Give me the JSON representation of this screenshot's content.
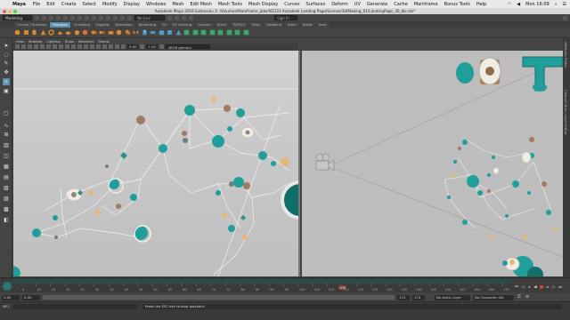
{
  "macmenu": {
    "app": "Maya",
    "items": [
      "File",
      "Edit",
      "Create",
      "Select",
      "Modify",
      "Display",
      "Windows",
      "Mesh",
      "Edit Mesh",
      "Mesh Tools",
      "Mesh Display",
      "Curves",
      "Surfaces",
      "Deform",
      "UV",
      "Generate",
      "Cache",
      "Mainframe",
      "Bonus Tools",
      "Help"
    ],
    "clock": "Mon 16:09"
  },
  "window": {
    "title": "Autodesk Maya 2016 Extension 2: /Volumes/Mainframe_Jobs/N1233 Autodesk Landing Page/Scenes/3d/Making_01/LandingPage_30_bb.mb*"
  },
  "statusline": {
    "mode": "Modeling",
    "live_surface": "No Live Surface",
    "signin": "Sign In"
  },
  "shelf": {
    "tabs": [
      "Curves / Surfaces",
      "Polygons",
      "Sculpting",
      "Rigging",
      "Animation",
      "Rendering",
      "FX",
      "FX Caching",
      "Custom",
      "XGen",
      "TURTLE",
      "VRay",
      "Deadline",
      "Interl",
      "Bullet",
      "Xero"
    ],
    "active_tab": "Polygons"
  },
  "panel": {
    "menu": [
      "View",
      "Shading",
      "Lighting",
      "Show",
      "Renderer",
      "Panels"
    ],
    "near": "0.00",
    "far": "1.00",
    "colorspace": "sRGB gamma"
  },
  "side_tabs": [
    "Attribute Editor",
    "Channel Box / Layer Editor"
  ],
  "timeline": {
    "ticks": [
      "5",
      "10",
      "15",
      "20",
      "25",
      "30",
      "35",
      "40",
      "45",
      "50",
      "55",
      "60",
      "65",
      "70",
      "75",
      "80",
      "85",
      "90",
      "95",
      "100",
      "105",
      "110",
      "115",
      "120",
      "125",
      "130",
      "135",
      "140",
      "145",
      "150",
      "155",
      "160",
      "165",
      "170"
    ],
    "current_frame": "100",
    "start_field": "0.00",
    "start_field2": "0.00",
    "end_field": "174",
    "end_field2": "174",
    "anim_layer": "No Anim Layer",
    "char_set": "No Character Set"
  },
  "helpline": {
    "mel": "MEL",
    "message": "Press the ESC key to stop playback."
  },
  "colors": {
    "teal": "#1f9e9a",
    "accent": "#5b8fb0",
    "tan": "#e2b877",
    "brown": "#a07a63"
  }
}
